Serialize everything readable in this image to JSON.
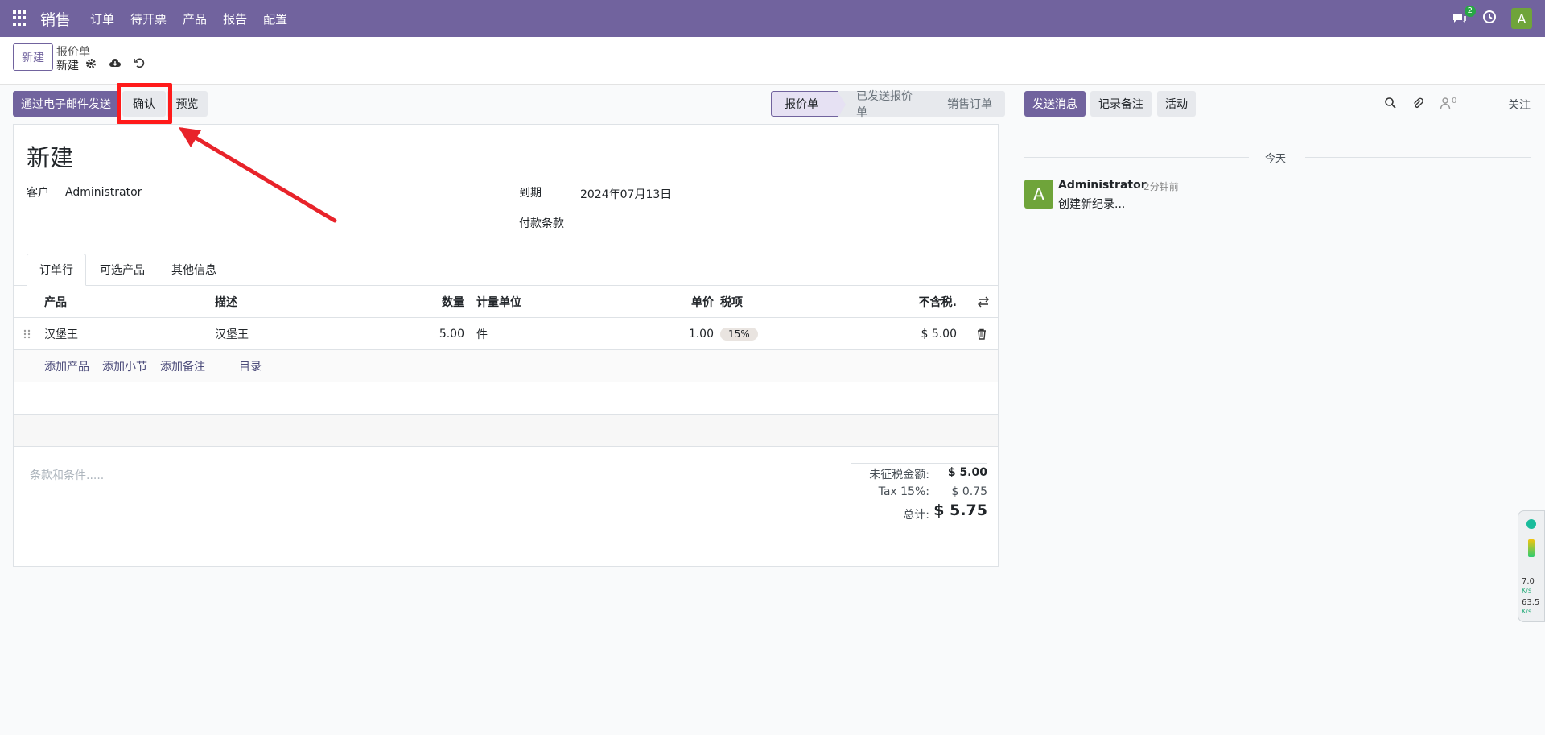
{
  "navbar": {
    "brand": "销售",
    "menu": [
      "订单",
      "待开票",
      "产品",
      "报告",
      "配置"
    ],
    "chat_badge": "2",
    "user_initial": "A"
  },
  "control": {
    "new_label": "新建",
    "breadcrumb_parent": "报价单",
    "breadcrumb_current": "新建"
  },
  "actions": {
    "send_email": "通过电子邮件发送",
    "confirm": "确认",
    "preview": "预览"
  },
  "pipeline": {
    "stages": [
      "报价单",
      "已发送报价单",
      "销售订单"
    ],
    "active_index": 0
  },
  "form": {
    "title": "新建",
    "customer_label": "客户",
    "customer_value": "Administrator",
    "expiry_label": "到期",
    "expiry_value": "2024年07月13日",
    "payment_terms_label": "付款条款",
    "tabs": [
      "订单行",
      "可选产品",
      "其他信息"
    ],
    "columns": {
      "product": "产品",
      "description": "描述",
      "quantity": "数量",
      "uom": "计量单位",
      "unit_price": "单价",
      "taxes": "税项",
      "subtotal": "不含税."
    },
    "lines": [
      {
        "product": "汉堡王",
        "description": "汉堡王",
        "quantity": "5.00",
        "uom": "件",
        "unit_price": "1.00",
        "tax": "15%",
        "subtotal": "$ 5.00"
      }
    ],
    "add_links": [
      "添加产品",
      "添加小节",
      "添加备注",
      "目录"
    ],
    "terms_placeholder": "条款和条件.....",
    "totals": {
      "untaxed_label": "未征税金额:",
      "untaxed_value": "$ 5.00",
      "tax_label": "Tax 15%:",
      "tax_value": "$ 0.75",
      "total_label": "总计:",
      "total_value": "$ 5.75"
    }
  },
  "chatter": {
    "send_message": "发送消息",
    "log_note": "记录备注",
    "activity": "活动",
    "follower_count": "0",
    "follow": "关注",
    "date_separator": "今天",
    "message": {
      "avatar_initial": "A",
      "author": "Administrator",
      "time": "- 2分钟前",
      "body": "创建新纪录..."
    }
  },
  "widget": {
    "upload_speed": "7.0",
    "download_speed": "63.5",
    "unit": "K/s"
  },
  "colors": {
    "brand": "#71639e",
    "annotation": "#ff1a1a",
    "avatar": "#6fa43a"
  }
}
